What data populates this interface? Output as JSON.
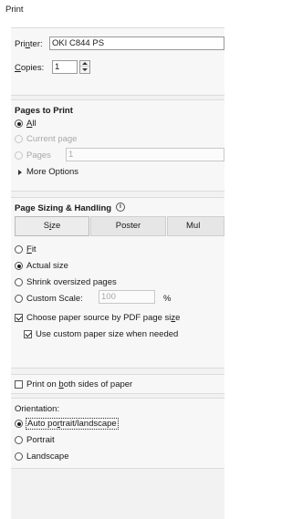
{
  "window": {
    "title": "Print"
  },
  "printer": {
    "label_pre": "Pri",
    "label_u": "n",
    "label_post": "ter:",
    "value": "OKI C844 PS"
  },
  "copies": {
    "label_u": "C",
    "label_post": "opies:",
    "value": "1"
  },
  "pages_to_print": {
    "heading": "Pages to Print",
    "all_label_u": "A",
    "all_label_post": "ll",
    "current_page_label": "Current page",
    "pages_label": "Pages",
    "pages_value": "1",
    "more_options_label": "More Options"
  },
  "page_sizing": {
    "heading": "Page Sizing & Handling",
    "info_glyph": "i",
    "buttons": {
      "size_pre": "S",
      "size_u": "i",
      "size_post": "ze",
      "poster": "Poster",
      "multiple": "Mul"
    },
    "fit_label_u": "F",
    "fit_label_post": "it",
    "actual_size_label": "Actual size",
    "shrink_label": "Shrink oversized pages",
    "custom_scale_label": "Custom Scale:",
    "custom_scale_value": "100",
    "percent_sign": "%",
    "choose_source_pre": "Choose paper source by PDF page si",
    "choose_source_u": "z",
    "choose_source_post": "e",
    "use_custom_label": "Use custom paper size when needed"
  },
  "both_sides": {
    "label_pre": "Print on ",
    "label_u": "b",
    "label_post": "oth sides of paper"
  },
  "orientation": {
    "heading": "Orientation:",
    "auto_pre": "Auto po",
    "auto_u": "r",
    "auto_post": "trait/landscape",
    "portrait_label": "Portrait",
    "landscape_label": "Landscape"
  }
}
